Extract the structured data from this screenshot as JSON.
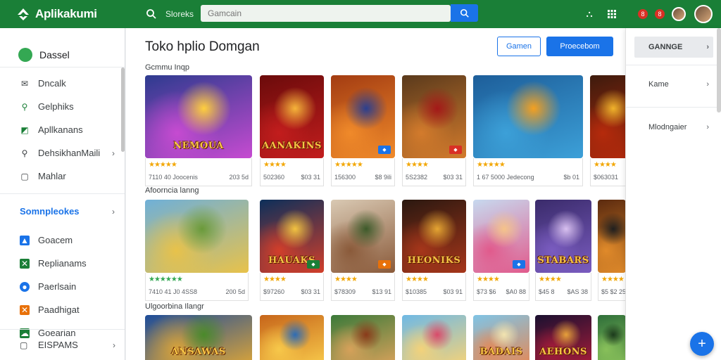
{
  "app": {
    "name": "Aplikakumi"
  },
  "topbar": {
    "search_label": "Sloreks",
    "search_placeholder": "Gamcain",
    "notif_1": "8",
    "notif_2": "8"
  },
  "sidebar": {
    "header": "Dassel",
    "items": [
      {
        "label": "Dncalk",
        "icon": "mail-icon"
      },
      {
        "label": "Gelphiks",
        "icon": "pin-icon"
      },
      {
        "label": "Apllkanans",
        "icon": "chart-icon"
      },
      {
        "label": "DehsikhanMaili",
        "icon": "search-icon"
      },
      {
        "label": "Mahlar",
        "icon": "box-icon"
      }
    ],
    "section": "Somnpleokes",
    "sub_items": [
      {
        "label": "Goacem",
        "color": "#1a73e8",
        "icon": "app-icon"
      },
      {
        "label": "Replianams",
        "color": "#1a7f37",
        "icon": "x-icon"
      },
      {
        "label": "Paerlsain",
        "color": "#1a73e8",
        "icon": "chat-icon"
      },
      {
        "label": "Paadhigat",
        "color": "#e8710a",
        "icon": "x-icon"
      },
      {
        "label": "Goearian",
        "color": "#1a7f37",
        "icon": "cloud-icon"
      }
    ],
    "footer": "EISPAMS"
  },
  "main": {
    "title": "Toko hplio Domgan",
    "btn_secondary": "Gamen",
    "btn_primary": "Proecebom",
    "sections": [
      {
        "label": "Gcmmu Inqp",
        "cards": [
          {
            "art_title": "NEMOUA",
            "stars": "★★★★★",
            "left": "7110 40 Joocenis",
            "right": "203 5d"
          },
          {
            "art_title": "AANAKINS",
            "stars": "★★★★",
            "left": "502360",
            "right": "$03 31"
          },
          {
            "art_title": "",
            "stars": "★★★★★",
            "left": "156300",
            "right": "$8 9ili"
          },
          {
            "art_title": "",
            "stars": "★★★★",
            "left": "5S2382",
            "right": "$03 31"
          },
          {
            "art_title": "",
            "stars": "★★★★★",
            "left": "1 67 5000 Jedecong",
            "right": "$b 01"
          },
          {
            "art_title": "",
            "stars": "★★★★",
            "left": "$063031",
            "right": ""
          }
        ]
      },
      {
        "label": "Afoorncia lanng",
        "cards": [
          {
            "art_title": "",
            "stars": "★★★★★★",
            "left": "7410 41 J0 4SS8",
            "right": "200 5d"
          },
          {
            "art_title": "HAUAKS",
            "stars": "★★★★",
            "left": "$97260",
            "right": "$03 31"
          },
          {
            "art_title": "",
            "stars": "★★★★",
            "left": "$78309",
            "right": "$13 91"
          },
          {
            "art_title": "HEONIKS",
            "stars": "★★★★",
            "left": "$10385",
            "right": "$03 91"
          },
          {
            "art_title": "",
            "stars": "★★★★",
            "left": "$73 $6",
            "right": "$A0 88"
          },
          {
            "art_title": "STABARS",
            "stars": "★★★★",
            "left": "$45 8",
            "right": "$AS 38"
          },
          {
            "art_title": "",
            "stars": "★★★★",
            "left": "$5 $2 25",
            "right": ""
          }
        ]
      },
      {
        "label": "Ulgoorbina Ilangr",
        "cards": [
          {
            "art_title": "ANSAWAS"
          },
          {
            "art_title": ""
          },
          {
            "art_title": ""
          },
          {
            "art_title": ""
          },
          {
            "art_title": "BADAIS"
          },
          {
            "art_title": "AEHONS"
          },
          {
            "art_title": ""
          }
        ]
      }
    ]
  },
  "rpanel": {
    "items": [
      "GANNGE",
      "Kame",
      "Mlodngaier"
    ]
  },
  "colors": {
    "brand": "#1a7f37",
    "accent": "#1a73e8",
    "star_gold": "#f2a600",
    "star_green": "#34a853"
  }
}
